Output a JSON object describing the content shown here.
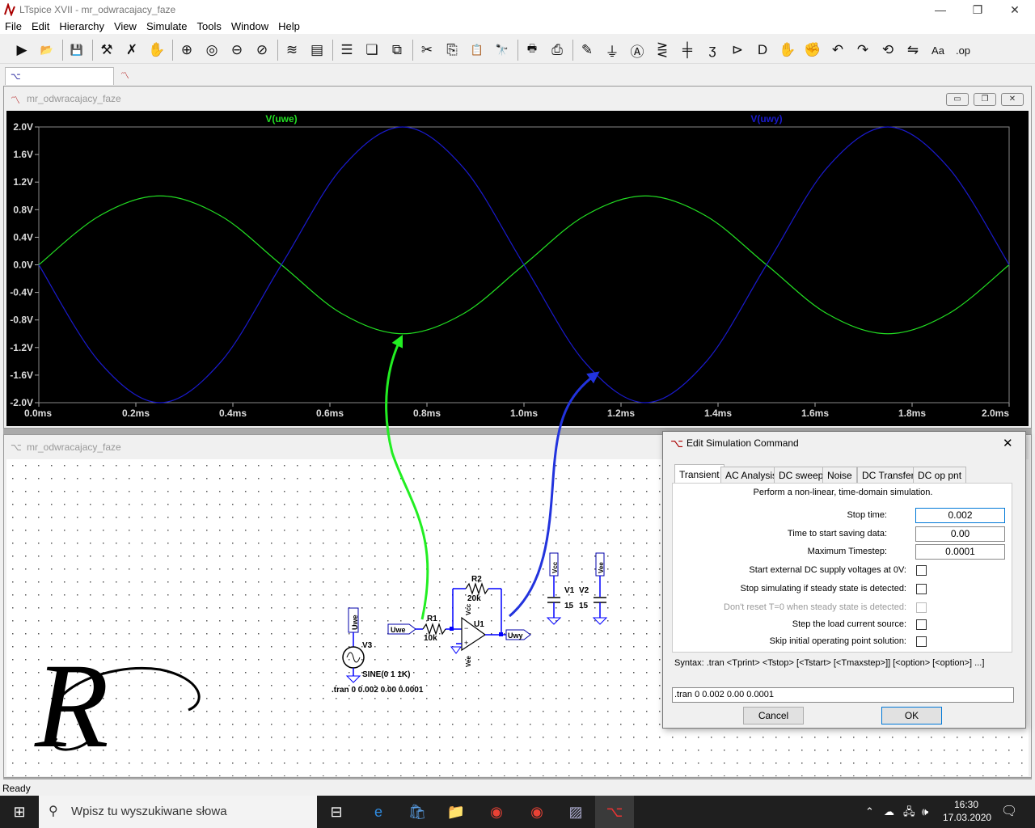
{
  "app": {
    "title": "LTspice XVII - mr_odwracajacy_faze",
    "window_buttons": {
      "minimize": "—",
      "restore": "❐",
      "close": "✕"
    }
  },
  "menu": [
    "File",
    "Edit",
    "Hierarchy",
    "View",
    "Simulate",
    "Tools",
    "Window",
    "Help"
  ],
  "toolbar": [
    {
      "name": "run-icon",
      "glyph": "▶"
    },
    {
      "name": "open-folder-icon",
      "glyph": "📂"
    },
    {
      "name": "save-icon",
      "glyph": "💾"
    },
    {
      "name": "control-panel-icon",
      "glyph": "⚒"
    },
    {
      "name": "halt-icon",
      "glyph": "✗"
    },
    {
      "name": "pan-hand-icon",
      "glyph": "✋"
    },
    {
      "name": "zoom-in-icon",
      "glyph": "⊕"
    },
    {
      "name": "zoom-area-icon",
      "glyph": "◎"
    },
    {
      "name": "zoom-out-icon",
      "glyph": "⊖"
    },
    {
      "name": "zoom-cancel-icon",
      "glyph": "⊘"
    },
    {
      "name": "autorange-icon",
      "glyph": "≋"
    },
    {
      "name": "waveform-grid-icon",
      "glyph": "▤"
    },
    {
      "name": "tile-horizontal-icon",
      "glyph": "☰"
    },
    {
      "name": "cascade-icon",
      "glyph": "❏"
    },
    {
      "name": "tile-vertical-icon",
      "glyph": "⧉"
    },
    {
      "name": "cut-icon",
      "glyph": "✂"
    },
    {
      "name": "copy-icon",
      "glyph": "⎘"
    },
    {
      "name": "paste-icon",
      "glyph": "📋"
    },
    {
      "name": "find-icon",
      "glyph": "🔭"
    },
    {
      "name": "print-preview-icon",
      "glyph": "🖶"
    },
    {
      "name": "print-icon",
      "glyph": "⎙"
    },
    {
      "name": "draw-wire-icon",
      "glyph": "✎"
    },
    {
      "name": "ground-icon",
      "glyph": "⏚"
    },
    {
      "name": "label-net-icon",
      "glyph": "Ⓐ"
    },
    {
      "name": "resistor-icon",
      "glyph": "⋛"
    },
    {
      "name": "capacitor-icon",
      "glyph": "╪"
    },
    {
      "name": "inductor-icon",
      "glyph": "ʒ"
    },
    {
      "name": "diode-icon",
      "glyph": "⊳"
    },
    {
      "name": "component-icon",
      "glyph": "D"
    },
    {
      "name": "move-icon",
      "glyph": "✋"
    },
    {
      "name": "drag-icon",
      "glyph": "✊"
    },
    {
      "name": "undo-icon",
      "glyph": "↶"
    },
    {
      "name": "redo-icon",
      "glyph": "↷"
    },
    {
      "name": "rotate-icon",
      "glyph": "⟲"
    },
    {
      "name": "mirror-icon",
      "glyph": "⇋"
    },
    {
      "name": "text-icon",
      "glyph": "Aa"
    },
    {
      "name": "spice-directive-icon",
      "glyph": ".op"
    }
  ],
  "doc_tabs": [
    {
      "label": "mr_odwracajacy_faze",
      "icon": "schematic-icon"
    },
    {
      "label": "mr_odwracajacy_faze",
      "icon": "waveform-icon"
    }
  ],
  "waveform_window": {
    "title": "mr_odwracajacy_faze"
  },
  "schematic_window": {
    "title": "mr_odwracajacy_faze"
  },
  "chart_data": {
    "type": "line",
    "x_unit": "ms",
    "xlim": [
      0,
      2.0
    ],
    "ylim": [
      -2.0,
      2.0
    ],
    "x_ticks": [
      "0.0ms",
      "0.2ms",
      "0.4ms",
      "0.6ms",
      "0.8ms",
      "1.0ms",
      "1.2ms",
      "1.4ms",
      "1.6ms",
      "1.8ms",
      "2.0ms"
    ],
    "y_ticks": [
      "2.0V",
      "1.6V",
      "1.2V",
      "0.8V",
      "0.4V",
      "0.0V",
      "-0.4V",
      "-0.8V",
      "-1.2V",
      "-1.6V",
      "-2.0V"
    ],
    "grid": false,
    "background": "#000000",
    "series": [
      {
        "name": "V(uwe)",
        "color": "#22dd22",
        "x": [
          0,
          0.125,
          0.25,
          0.375,
          0.5,
          0.625,
          0.75,
          0.875,
          1.0,
          1.125,
          1.25,
          1.375,
          1.5,
          1.625,
          1.75,
          1.875,
          2.0
        ],
        "y": [
          0,
          0.71,
          1.0,
          0.71,
          0,
          -0.71,
          -1.0,
          -0.71,
          0,
          0.71,
          1.0,
          0.71,
          0,
          -0.71,
          -1.0,
          -0.71,
          0
        ]
      },
      {
        "name": "V(uwy)",
        "color": "#1a1acc",
        "x": [
          0,
          0.125,
          0.25,
          0.375,
          0.5,
          0.625,
          0.75,
          0.875,
          1.0,
          1.125,
          1.25,
          1.375,
          1.5,
          1.625,
          1.75,
          1.875,
          2.0
        ],
        "y": [
          0,
          -1.41,
          -2.0,
          -1.41,
          0,
          1.41,
          2.0,
          1.41,
          0,
          -1.41,
          -2.0,
          -1.41,
          0,
          1.41,
          2.0,
          1.41,
          0
        ]
      }
    ]
  },
  "schematic": {
    "net_uwe": "Uwe",
    "net_uwy": "Uwy",
    "r1_name": "R1",
    "r1_value": "10k",
    "r2_name": "R2",
    "r2_value": "20k",
    "u1_name": "U1",
    "v1_name": "V1",
    "v1_value": "15",
    "v2_name": "V2",
    "v2_value": "15",
    "v3_name": "V3",
    "v3_value": "SINE(0 1 1K)",
    "vcc_label": "Vcc",
    "vee_label": "Vee",
    "directive": ".tran 0 0.002 0.00 0.0001",
    "arrow_green_color": "#22ee22",
    "arrow_blue_color": "#2233dd"
  },
  "dialog": {
    "title": "Edit Simulation Command",
    "close": "✕",
    "tabs": [
      "Transient",
      "AC Analysis",
      "DC sweep",
      "Noise",
      "DC Transfer",
      "DC op pnt"
    ],
    "description": "Perform a non-linear, time-domain simulation.",
    "fields": [
      {
        "label": "Stop time:",
        "value": "0.002"
      },
      {
        "label": "Time to start saving data:",
        "value": "0.00"
      },
      {
        "label": "Maximum Timestep:",
        "value": "0.0001"
      }
    ],
    "checkboxes": [
      {
        "label": "Start external DC supply voltages at 0V:",
        "disabled": false
      },
      {
        "label": "Stop simulating if steady state is detected:",
        "disabled": false
      },
      {
        "label": "Don't reset T=0 when steady state is detected:",
        "disabled": true
      },
      {
        "label": "Step the load current source:",
        "disabled": false
      },
      {
        "label": "Skip initial operating point solution:",
        "disabled": false
      }
    ],
    "syntax": "Syntax:  .tran <Tprint> <Tstop> [<Tstart> [<Tmaxstep>]] [<option> [<option>] ...]",
    "command": ".tran 0 0.002 0.00 0.0001",
    "cancel": "Cancel",
    "ok": "OK"
  },
  "status": "Ready",
  "taskbar": {
    "search_placeholder": "Wpisz tu wyszukiwane słowa",
    "time": "16:30",
    "date": "17.03.2020"
  }
}
